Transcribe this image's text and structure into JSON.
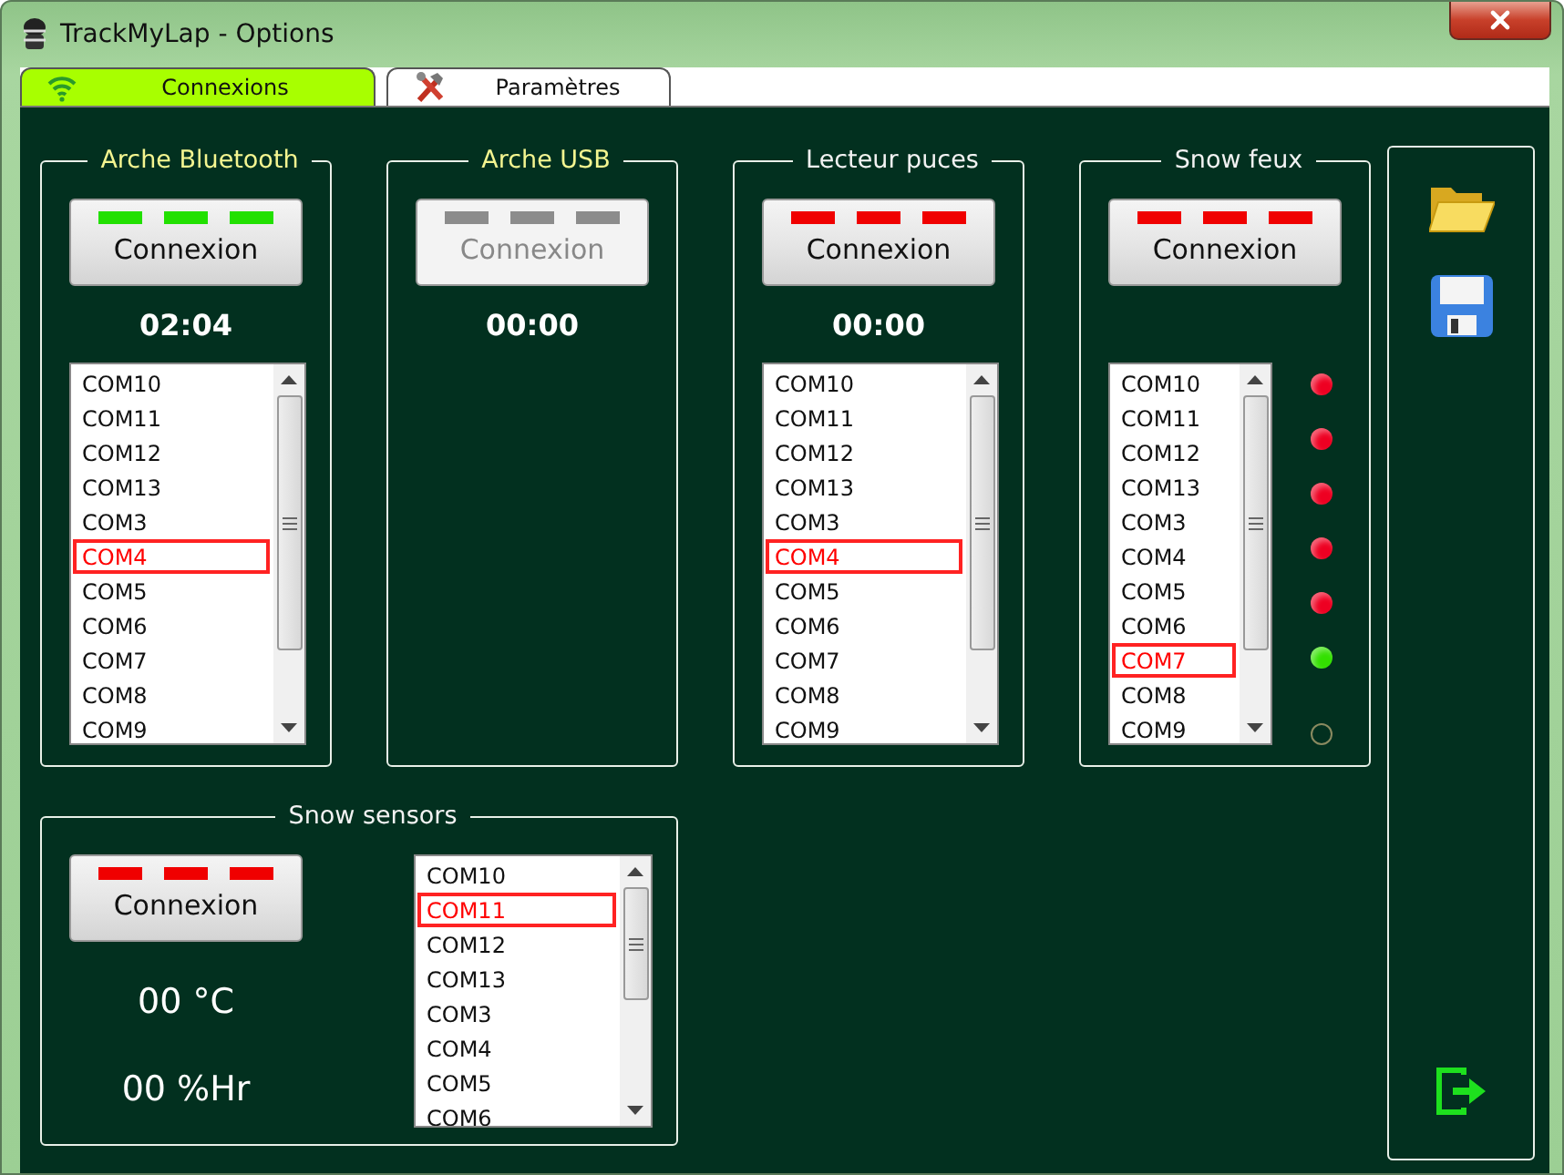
{
  "window": {
    "title": "TrackMyLap - Options"
  },
  "tabs": [
    {
      "label": "Connexions",
      "selected": true
    },
    {
      "label": "Paramètres",
      "selected": false
    }
  ],
  "groups": [
    {
      "title": "Arche Bluetooth",
      "accent": true,
      "color": "#22e000",
      "button": {
        "label": "Connexion",
        "disabled": false
      },
      "timer": "02:04",
      "ports": [
        {
          "label": "COM10",
          "selected": false
        },
        {
          "label": "COM11",
          "selected": false
        },
        {
          "label": "COM12",
          "selected": false
        },
        {
          "label": "COM13",
          "selected": false
        },
        {
          "label": "COM3",
          "selected": false
        },
        {
          "label": "COM4",
          "selected": true
        },
        {
          "label": "COM5",
          "selected": false
        },
        {
          "label": "COM6",
          "selected": false
        },
        {
          "label": "COM7",
          "selected": false
        },
        {
          "label": "COM8",
          "selected": false
        },
        {
          "label": "COM9",
          "selected": false
        }
      ]
    },
    {
      "title": "Arche USB",
      "accent": true,
      "color": "#8c8c8c",
      "button": {
        "label": "Connexion",
        "disabled": true
      },
      "timer": "00:00"
    },
    {
      "title": "Lecteur puces",
      "accent": false,
      "color": "#f00000",
      "button": {
        "label": "Connexion",
        "disabled": false
      },
      "timer": "00:00",
      "ports": [
        {
          "label": "COM10",
          "selected": false
        },
        {
          "label": "COM11",
          "selected": false
        },
        {
          "label": "COM12",
          "selected": false
        },
        {
          "label": "COM13",
          "selected": false
        },
        {
          "label": "COM3",
          "selected": false
        },
        {
          "label": "COM4",
          "selected": true
        },
        {
          "label": "COM5",
          "selected": false
        },
        {
          "label": "COM6",
          "selected": false
        },
        {
          "label": "COM7",
          "selected": false
        },
        {
          "label": "COM8",
          "selected": false
        },
        {
          "label": "COM9",
          "selected": false
        }
      ]
    },
    {
      "title": "Snow feux",
      "accent": false,
      "color": "#f00000",
      "button": {
        "label": "Connexion",
        "disabled": false
      },
      "ports": [
        {
          "label": "COM10",
          "selected": false
        },
        {
          "label": "COM11",
          "selected": false
        },
        {
          "label": "COM12",
          "selected": false
        },
        {
          "label": "COM13",
          "selected": false
        },
        {
          "label": "COM3",
          "selected": false
        },
        {
          "label": "COM4",
          "selected": false
        },
        {
          "label": "COM5",
          "selected": false
        },
        {
          "label": "COM6",
          "selected": false
        },
        {
          "label": "COM7",
          "selected": true
        },
        {
          "label": "COM8",
          "selected": false
        },
        {
          "label": "COM9",
          "selected": false
        }
      ],
      "lights": [
        {
          "on": true,
          "color": "#ee0022"
        },
        {
          "on": true,
          "color": "#ee0022"
        },
        {
          "on": true,
          "color": "#ee0022"
        },
        {
          "on": true,
          "color": "#ee0022"
        },
        {
          "on": true,
          "color": "#ee0022"
        },
        {
          "on": true,
          "color": "#33e000"
        },
        {
          "on": false,
          "color": "#8a8a60"
        }
      ]
    }
  ],
  "sensors": {
    "title": "Snow sensors",
    "color": "#f00000",
    "button": {
      "label": "Connexion",
      "disabled": false
    },
    "temperature": "00 °C",
    "humidity": "00 %Hr",
    "ports": [
      {
        "label": "COM10",
        "selected": false
      },
      {
        "label": "COM11",
        "selected": true
      },
      {
        "label": "COM12",
        "selected": false
      },
      {
        "label": "COM13",
        "selected": false
      },
      {
        "label": "COM3",
        "selected": false
      },
      {
        "label": "COM4",
        "selected": false
      },
      {
        "label": "COM5",
        "selected": false
      },
      {
        "label": "COM6",
        "selected": false
      }
    ]
  }
}
